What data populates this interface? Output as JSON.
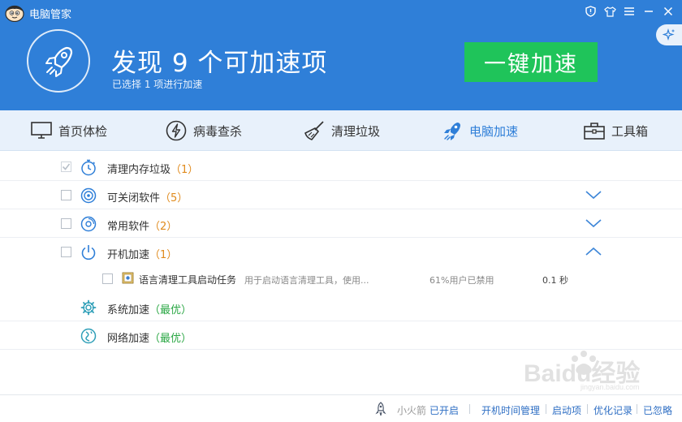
{
  "window": {
    "title": "电脑管家"
  },
  "hero": {
    "headline": "发现 9 个可加速项",
    "subline": "已选择 1 项进行加速",
    "button_label": "一键加速"
  },
  "nav": {
    "items": [
      {
        "label": "首页体检",
        "icon": "monitor-icon"
      },
      {
        "label": "病毒查杀",
        "icon": "lightning-icon"
      },
      {
        "label": "清理垃圾",
        "icon": "broom-icon"
      },
      {
        "label": "电脑加速",
        "icon": "rocket-icon",
        "active": true
      },
      {
        "label": "工具箱",
        "icon": "toolbox-icon"
      }
    ]
  },
  "list": {
    "rows": [
      {
        "label": "清理内存垃圾",
        "count": "（1）",
        "checked": true,
        "icon": "stopwatch-icon"
      },
      {
        "label": "可关闭软件",
        "count": "（5）",
        "checked": false,
        "icon": "target-icon",
        "expanded": false
      },
      {
        "label": "常用软件",
        "count": "（2）",
        "checked": false,
        "icon": "disc-icon",
        "expanded": false
      },
      {
        "label": "开机加速",
        "count": "（1）",
        "checked": false,
        "icon": "power-icon",
        "expanded": true
      }
    ],
    "subitem": {
      "name": "语言清理工具启动任务",
      "desc": "用于启动语言清理工具，使用...",
      "pct": "61%用户已禁用",
      "time": "0.1 秒"
    },
    "optimized": [
      {
        "label": "系统加速",
        "status": "（最优）",
        "icon": "gear-icon"
      },
      {
        "label": "网络加速",
        "status": "（最优）",
        "icon": "network-icon"
      }
    ]
  },
  "footer": {
    "rocket_label": "小火箭",
    "rocket_status": "已开启",
    "links": [
      "开机时间管理",
      "启动项",
      "优化记录",
      "已忽略"
    ]
  },
  "watermark": {
    "text": "Baidu经验",
    "sub": "jingyan.baidu.com"
  },
  "colors": {
    "header_blue": "#2f7fd8",
    "accent_green": "#1fc45a",
    "count_orange": "#e08a1c",
    "best_green": "#2aa744"
  }
}
